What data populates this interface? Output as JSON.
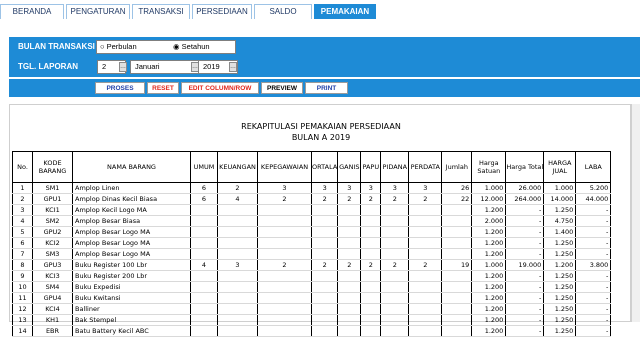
{
  "tabs": [
    {
      "label": "BERANDA",
      "active": false
    },
    {
      "label": "PENGATURAN",
      "active": false
    },
    {
      "label": "TRANSAKSI",
      "active": false
    },
    {
      "label": "PERSEDIAAN",
      "active": false
    },
    {
      "label": "SALDO",
      "active": false
    },
    {
      "label": "PEMAKAIAN",
      "active": true
    }
  ],
  "filter": {
    "bulan_label": "BULAN TRANSAKSI",
    "option_perbulan": "Perbulan",
    "option_setahun": "Setahun",
    "selected": "Setahun",
    "tgl_label": "TGL. LAPORAN",
    "day": "2",
    "month": "Januari",
    "year": "2019"
  },
  "actions": {
    "proses": "PROSES",
    "reset": "RESET",
    "edit": "EDIT COLUMN/ROW",
    "preview": "PREVIEW",
    "print": "PRINT"
  },
  "colors": {
    "accent": "#1e8bd6",
    "proses": "#1f3fa8",
    "reset": "#e0271c",
    "edit": "#e0271c",
    "preview": "#000000",
    "print": "#1f3fa8"
  },
  "report": {
    "title": "REKAPITULASI PEMAKAIAN PERSEDIAAN",
    "subtitle": "BULAN A 2019",
    "columns": [
      "No.",
      "KODE BARANG",
      "NAMA BARANG",
      "UMUM",
      "KEUANGAN",
      "KEPEGAWAIAN",
      "ORTALA",
      "GANIS",
      "PAPU",
      "PIDANA",
      "PERDATA",
      "Jumlah",
      "Harga Satuan",
      "Harga Total",
      "HARGA JUAL",
      "LABA"
    ],
    "rows": [
      [
        "1",
        "SM1",
        "Amplop Linen",
        "6",
        "2",
        "3",
        "3",
        "3",
        "3",
        "3",
        "3",
        "26",
        "1.000",
        "26.000",
        "1.000",
        "5.200"
      ],
      [
        "2",
        "GPU1",
        "Amplop Dinas Kecil Biasa",
        "6",
        "4",
        "2",
        "2",
        "2",
        "2",
        "2",
        "2",
        "22",
        "12.000",
        "264.000",
        "14.000",
        "44.000"
      ],
      [
        "3",
        "KCI1",
        "Amplop Kecil Logo MA",
        "",
        "",
        "",
        "",
        "",
        "",
        "",
        "",
        "",
        "1.200",
        "-",
        "1.250",
        "-"
      ],
      [
        "4",
        "SM2",
        "Amplop Besar Biasa",
        "",
        "",
        "",
        "",
        "",
        "",
        "",
        "",
        "",
        "2.000",
        "-",
        "4.750",
        "-"
      ],
      [
        "5",
        "GPU2",
        "Amplop Besar Logo MA",
        "",
        "",
        "",
        "",
        "",
        "",
        "",
        "",
        "",
        "1.200",
        "-",
        "1.400",
        "-"
      ],
      [
        "6",
        "KCI2",
        "Amplop Besar Logo MA",
        "",
        "",
        "",
        "",
        "",
        "",
        "",
        "",
        "",
        "1.200",
        "-",
        "1.250",
        "-"
      ],
      [
        "7",
        "SM3",
        "Amplop Besar Logo MA",
        "",
        "",
        "",
        "",
        "",
        "",
        "",
        "",
        "",
        "1.200",
        "-",
        "1.250",
        "-"
      ],
      [
        "8",
        "GPU3",
        "Buku Register 100 Lbr",
        "4",
        "3",
        "2",
        "2",
        "2",
        "2",
        "2",
        "2",
        "19",
        "1.000",
        "19.000",
        "1.200",
        "3.800"
      ],
      [
        "9",
        "KCI3",
        "Buku Register 200 Lbr",
        "",
        "",
        "",
        "",
        "",
        "",
        "",
        "",
        "",
        "1.200",
        "-",
        "1.250",
        "-"
      ],
      [
        "10",
        "SM4",
        "Buku Expedisi",
        "",
        "",
        "",
        "",
        "",
        "",
        "",
        "",
        "",
        "1.200",
        "-",
        "1.250",
        "-"
      ],
      [
        "11",
        "GPU4",
        "Buku Kwitansi",
        "",
        "",
        "",
        "",
        "",
        "",
        "",
        "",
        "",
        "1.200",
        "-",
        "1.250",
        "-"
      ],
      [
        "12",
        "KCI4",
        "Balliner",
        "",
        "",
        "",
        "",
        "",
        "",
        "",
        "",
        "",
        "1.200",
        "-",
        "1.250",
        "-"
      ],
      [
        "13",
        "KH1",
        "Bak Stempel",
        "",
        "",
        "",
        "",
        "",
        "",
        "",
        "",
        "",
        "1.200",
        "-",
        "1.250",
        "-"
      ],
      [
        "14",
        "EBR",
        "Batu Battery Kecil ABC",
        "",
        "",
        "",
        "",
        "",
        "",
        "",
        "",
        "",
        "1.200",
        "-",
        "1.250",
        "-"
      ]
    ]
  }
}
